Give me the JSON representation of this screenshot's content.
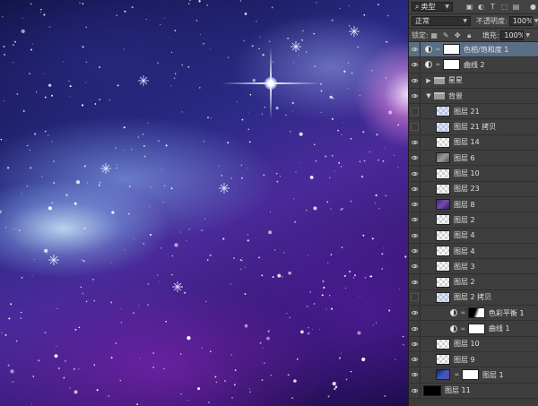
{
  "panel": {
    "filter": {
      "kind_label": "类型",
      "icons": [
        "image-icon",
        "adjustment-icon",
        "type-icon",
        "shape-icon",
        "smart-object-icon"
      ]
    },
    "blend": {
      "mode": "正常",
      "opacity_label": "不透明度:",
      "opacity_value": "100%"
    },
    "lock": {
      "label": "锁定:",
      "fill_label": "填充:",
      "fill_value": "100%"
    },
    "layers": [
      {
        "name": "色相/饱和度 1",
        "type": "adjustment",
        "visible": true,
        "selected": true,
        "indent": 0
      },
      {
        "name": "曲线 2",
        "type": "adjustment",
        "visible": true,
        "indent": 0
      },
      {
        "name": "星星",
        "type": "group",
        "visible": true,
        "expanded": false,
        "indent": 0
      },
      {
        "name": "背景",
        "type": "group",
        "visible": true,
        "expanded": true,
        "indent": 0
      },
      {
        "name": "图层 21",
        "type": "pixel",
        "visible": false,
        "thumb": "check-tint",
        "indent": 1
      },
      {
        "name": "图层 21 拷贝",
        "type": "pixel",
        "visible": false,
        "thumb": "check-tint",
        "indent": 1
      },
      {
        "name": "图层 14",
        "type": "pixel",
        "visible": true,
        "thumb": "check",
        "indent": 1
      },
      {
        "name": "图层 6",
        "type": "pixel",
        "visible": true,
        "thumb": "gray",
        "indent": 1
      },
      {
        "name": "图层 10",
        "type": "pixel",
        "visible": true,
        "thumb": "check",
        "indent": 1
      },
      {
        "name": "图层 23",
        "type": "pixel",
        "visible": true,
        "thumb": "check",
        "indent": 1
      },
      {
        "name": "图层 8",
        "type": "pixel",
        "visible": true,
        "thumb": "purp",
        "indent": 1
      },
      {
        "name": "图层 2",
        "type": "pixel",
        "visible": true,
        "thumb": "check",
        "indent": 1
      },
      {
        "name": "图层 4",
        "type": "pixel",
        "visible": true,
        "thumb": "check",
        "indent": 1
      },
      {
        "name": "图层 4",
        "type": "pixel",
        "visible": true,
        "thumb": "check",
        "indent": 1
      },
      {
        "name": "图层 3",
        "type": "pixel",
        "visible": true,
        "thumb": "check",
        "indent": 1
      },
      {
        "name": "图层 2",
        "type": "pixel",
        "visible": true,
        "thumb": "check",
        "indent": 1
      },
      {
        "name": "图层 2 拷贝",
        "type": "pixel",
        "visible": false,
        "thumb": "check-tint",
        "indent": 1
      },
      {
        "name": "色彩平衡 1",
        "type": "adjustment",
        "visible": true,
        "mask": "cbmask",
        "indent": 2
      },
      {
        "name": "曲线 1",
        "type": "adjustment",
        "visible": true,
        "indent": 2
      },
      {
        "name": "图层 10",
        "type": "pixel",
        "visible": true,
        "thumb": "check",
        "indent": 1
      },
      {
        "name": "图层 9",
        "type": "pixel",
        "visible": true,
        "thumb": "check",
        "indent": 1
      },
      {
        "name": "图层 1",
        "type": "pixel-mask",
        "visible": true,
        "thumb": "space",
        "indent": 1
      },
      {
        "name": "图层 11",
        "type": "pixel",
        "visible": true,
        "thumb": "black",
        "indent": 0
      }
    ]
  }
}
